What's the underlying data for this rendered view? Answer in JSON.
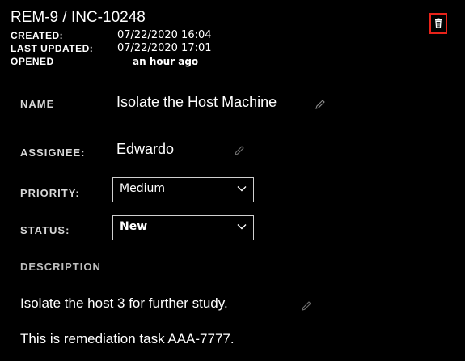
{
  "header": {
    "title": "REM-9 / INC-10248",
    "created_label": "CREATED:",
    "created_value": "07/22/2020 16:04",
    "updated_label": "LAST UPDATED:",
    "updated_value": "07/22/2020 17:01",
    "opened_label": "OPENED",
    "opened_value": "an hour ago"
  },
  "fields": {
    "name_label": "NAME",
    "name_value": "Isolate the Host Machine",
    "assignee_label": "ASSIGNEE:",
    "assignee_value": "Edwardo",
    "priority_label": "PRIORITY:",
    "priority_value": "Medium",
    "status_label": "STATUS:",
    "status_value": "New"
  },
  "description": {
    "label": "DESCRIPTION",
    "line1": "Isolate the host 3 for further study.",
    "line2": "This is remediation task AAA-7777."
  },
  "icons": {
    "delete": "trash-icon",
    "edit": "pencil-icon",
    "dropdown": "chevron-down-icon"
  },
  "colors": {
    "background": "#000000",
    "highlight": "#e8231a"
  }
}
